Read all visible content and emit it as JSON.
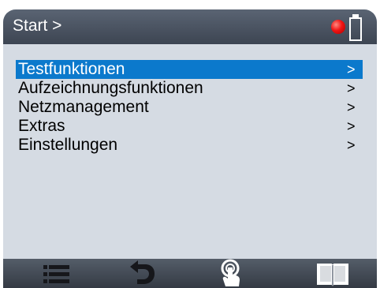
{
  "header": {
    "breadcrumb": "Start >"
  },
  "menu": {
    "items": [
      {
        "label": "Testfunktionen",
        "arrow": ">",
        "selected": true
      },
      {
        "label": "Aufzeichnungsfunktionen",
        "arrow": ">",
        "selected": false
      },
      {
        "label": "Netzmanagement",
        "arrow": ">",
        "selected": false
      },
      {
        "label": "Extras",
        "arrow": ">",
        "selected": false
      },
      {
        "label": "Einstellungen",
        "arrow": ">",
        "selected": false
      }
    ]
  },
  "status": {
    "indicator": "red-dot-icon",
    "battery": "battery-icon"
  },
  "bottombar": {
    "icons": [
      "list-icon",
      "back-arrow-icon",
      "touch-icon",
      "book-icon"
    ]
  },
  "colors": {
    "header_bg": "#4a5361",
    "screen_bg": "#d5dbe3",
    "selection": "#0b79cc",
    "status_red": "#f21414",
    "bottombar_icon": "#16171b"
  }
}
